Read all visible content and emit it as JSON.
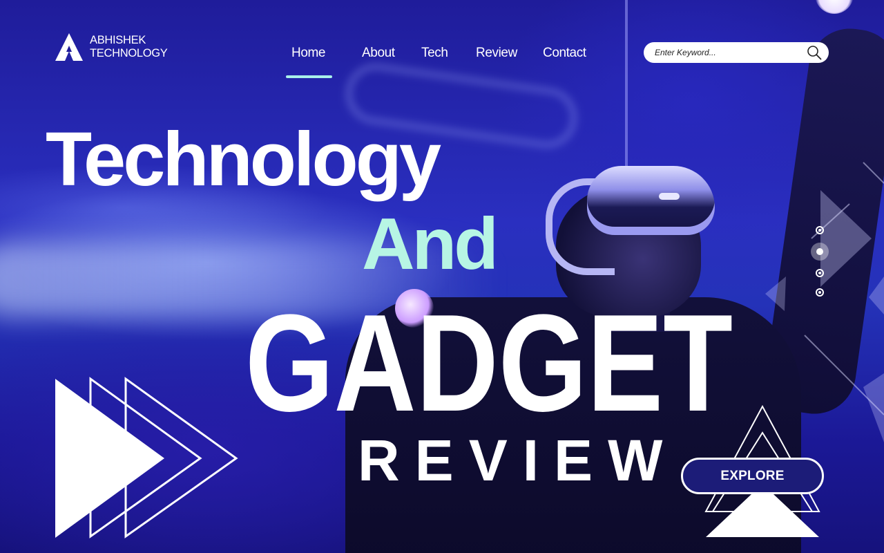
{
  "brand": {
    "line1": "ABHISHEK",
    "line2": "TECHNOLOGY",
    "icon": "logo-a-icon"
  },
  "nav": {
    "items": [
      {
        "label": "Home",
        "active": true
      },
      {
        "label": "About",
        "active": false
      },
      {
        "label": "Tech",
        "active": false
      },
      {
        "label": "Review",
        "active": false
      },
      {
        "label": "Contact",
        "active": false
      }
    ],
    "active_indicator_color": "#a9f0ea"
  },
  "search": {
    "placeholder": "Enter Keyword...",
    "value": "",
    "icon": "search-icon"
  },
  "hero": {
    "line1": "Technology",
    "line2": "And",
    "line3": "GADGET",
    "line4": "REVIEW",
    "accent_color": "#b7f5e4"
  },
  "slider": {
    "count": 4,
    "active_index": 1
  },
  "cta": {
    "label": "EXPLORE"
  },
  "colors": {
    "background": "#1f1c9a",
    "text": "#ffffff",
    "button_fill": "#1c1c78"
  }
}
